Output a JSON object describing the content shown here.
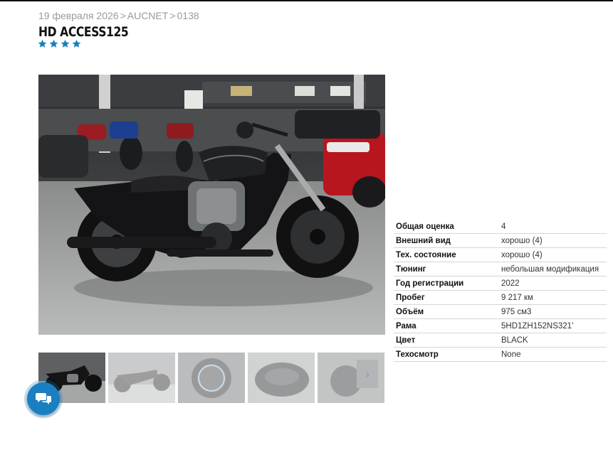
{
  "breadcrumb": {
    "date": "19 февраля 2026",
    "auction": "AUCNET",
    "lot": "0138",
    "sep": ">"
  },
  "lot": {
    "title": "HD ACCESS125",
    "rating_stars": 4,
    "star_color": "#1a7fc1"
  },
  "specs": [
    {
      "label": "Общая оценка",
      "value": "4"
    },
    {
      "label": "Внешний вид",
      "value": "хорошо (4)"
    },
    {
      "label": "Тех. состояние",
      "value": "хорошо (4)"
    },
    {
      "label": "Тюнинг",
      "value": "небольшая модификация"
    },
    {
      "label": "Год регистрации",
      "value": "2022"
    },
    {
      "label": "Пробег",
      "value": "9 217 км"
    },
    {
      "label": "Объём",
      "value": "975 см3"
    },
    {
      "label": "Рама",
      "value": "5HD1ZH152NS321'"
    },
    {
      "label": "Цвет",
      "value": "BLACK"
    },
    {
      "label": "Техосмотр",
      "value": "None"
    }
  ],
  "gallery": {
    "thumb_count": 5,
    "active_index": 0,
    "next_icon": "chevron-right-icon"
  },
  "chat": {
    "icon": "chat-bubbles-icon",
    "color": "#1a7fc1"
  }
}
